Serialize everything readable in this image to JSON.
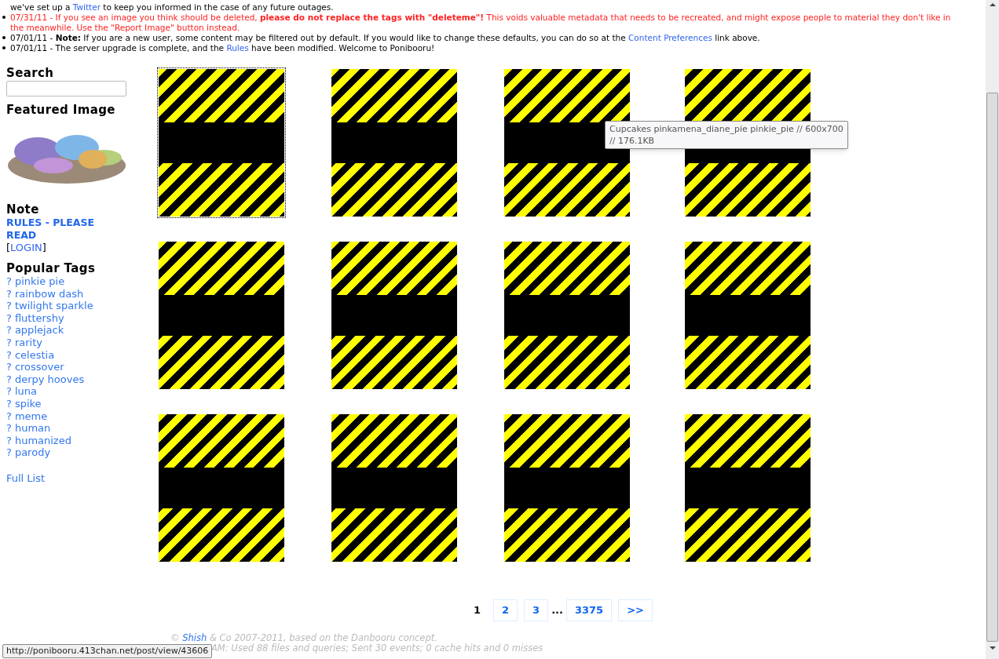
{
  "news": [
    {
      "kind": "normal",
      "bullet": false,
      "segments": [
        {
          "kind": "plain",
          "text": "we've set up a "
        },
        {
          "kind": "link",
          "text": "Twitter"
        },
        {
          "kind": "plain",
          "text": " to keep you informed in the case of any future outages."
        }
      ]
    },
    {
      "kind": "alert",
      "bullet": true,
      "segments": [
        {
          "kind": "plain",
          "text": "07/31/11 - If you see an image you think should be deleted, "
        },
        {
          "kind": "bold",
          "text": "please do not replace the tags with \"deleteme\"!"
        },
        {
          "kind": "plain",
          "text": " This voids valuable metadata that needs to be recreated, and might expose people to material they don't like in the meanwhile. Use the \"Report Image\" button instead."
        }
      ]
    },
    {
      "kind": "normal",
      "bullet": true,
      "segments": [
        {
          "kind": "plain",
          "text": "07/01/11 - "
        },
        {
          "kind": "bold",
          "text": "Note:"
        },
        {
          "kind": "plain",
          "text": " If you are a new user, some content may be filtered out by default. If you would like to change these defaults, you can do so at the "
        },
        {
          "kind": "link",
          "text": "Content Preferences"
        },
        {
          "kind": "plain",
          "text": " link above."
        }
      ]
    },
    {
      "kind": "normal",
      "bullet": true,
      "segments": [
        {
          "kind": "plain",
          "text": "07/01/11 - The server upgrade is complete, and the "
        },
        {
          "kind": "link",
          "text": "Rules"
        },
        {
          "kind": "plain",
          "text": " have been modified. Welcome to Ponibooru!"
        }
      ]
    }
  ],
  "sidebar": {
    "search_title": "Search",
    "featured_title": "Featured Image",
    "note_title": "Note",
    "note_link": "RULES - PLEASE READ",
    "login_open": "[",
    "login_link": "LOGIN",
    "login_close": "]",
    "tags_title": "Popular Tags",
    "tags": [
      "pinkie pie",
      "rainbow dash",
      "twilight sparkle",
      "fluttershy",
      "applejack",
      "rarity",
      "celestia",
      "crossover",
      "derpy hooves",
      "luna",
      "spike",
      "meme",
      "human",
      "humanized",
      "parody"
    ],
    "tag_marker": "?",
    "full_list": "Full List"
  },
  "thumbnails": [
    {
      "focused": true
    },
    {
      "focused": false
    },
    {
      "focused": false
    },
    {
      "focused": false
    },
    {
      "focused": false
    },
    {
      "focused": false
    },
    {
      "focused": false
    },
    {
      "focused": false
    },
    {
      "focused": false
    },
    {
      "focused": false
    },
    {
      "focused": false
    },
    {
      "focused": false
    }
  ],
  "tooltip": {
    "line_1": "Cupcakes pinkamena_diane_pie pinkie_pie // 600x700",
    "line_2": "// 176.1KB"
  },
  "pagination": [
    {
      "kind": "current",
      "label": "1"
    },
    {
      "kind": "page",
      "label": "2"
    },
    {
      "kind": "page",
      "label": "3"
    },
    {
      "kind": "gap",
      "label": "..."
    },
    {
      "kind": "page",
      "label": "3375"
    },
    {
      "kind": "next",
      "label": ">>"
    }
  ],
  "footer": [
    [
      {
        "kind": "plain",
        "text": "© "
      },
      {
        "kind": "link",
        "text": "Shish"
      },
      {
        "kind": "plain",
        "text": " & Co 2007-2011, based on the Danbooru concept."
      }
    ],
    [
      {
        "kind": "plain",
        "text": "AM: Used 88 files and queries; Sent 30 events; 0 cache hits and 0 misses"
      }
    ]
  ],
  "status_url": "http://ponibooru.413chan.net/post/view/43606"
}
